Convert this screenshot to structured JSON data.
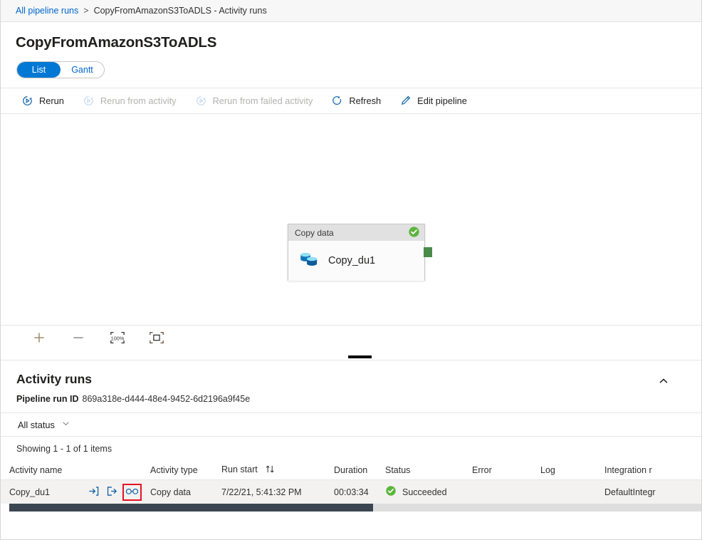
{
  "breadcrumb": {
    "root": "All pipeline runs",
    "separator": ">",
    "current": "CopyFromAmazonS3ToADLS - Activity runs"
  },
  "page": {
    "title": "CopyFromAmazonS3ToADLS"
  },
  "view_toggle": {
    "list_label": "List",
    "gantt_label": "Gantt",
    "selected": "List",
    "active_color": "#0078d4",
    "link_color": "#0066cc"
  },
  "command_bar": {
    "items": [
      {
        "label": "Rerun",
        "icon": "rerun-icon",
        "disabled": false
      },
      {
        "label": "Rerun from activity",
        "icon": "rerun-from-activity-icon",
        "disabled": true
      },
      {
        "label": "Rerun from failed activity",
        "icon": "rerun-from-failed-activity-icon",
        "disabled": true
      },
      {
        "label": "Refresh",
        "icon": "refresh-icon",
        "disabled": false
      },
      {
        "label": "Edit pipeline",
        "icon": "edit-pipeline-icon",
        "disabled": false
      }
    ]
  },
  "canvas": {
    "node": {
      "type_label": "Copy data",
      "name": "Copy_du1",
      "status_icon": "success-check-icon",
      "status_color": "#5cb53c",
      "activity_icon": "copy-data-icon",
      "port_color": "#4a8a4a"
    },
    "zoom_tools": [
      {
        "icon": "zoom-in-icon",
        "label": "+"
      },
      {
        "icon": "zoom-out-icon",
        "label": "—"
      },
      {
        "icon": "zoom-to-100-percent-icon",
        "label": "100%"
      },
      {
        "icon": "zoom-to-fit-icon",
        "label": ""
      }
    ]
  },
  "activity_runs": {
    "title": "Activity runs",
    "run_id_label": "Pipeline run ID",
    "run_id_value": "869a318e-d444-48e4-9452-6d2196a9f45e",
    "collapse_icon": "chevron-up-icon",
    "status_filter": {
      "label": "All status",
      "icon": "chevron-down-icon"
    },
    "showing_text": "Showing 1 - 1 of 1 items",
    "columns": [
      "Activity name",
      "Activity type",
      "Run start",
      "Duration",
      "Status",
      "Error",
      "Log",
      "Integration r"
    ],
    "sort_column": "Run start",
    "sort_icon": "sort-updown-icon",
    "rows": [
      {
        "activity_name": "Copy_du1",
        "row_icons": [
          {
            "name": "input-icon",
            "highlighted": false
          },
          {
            "name": "output-icon",
            "highlighted": false
          },
          {
            "name": "details-glasses-icon",
            "highlighted": true
          }
        ],
        "activity_type": "Copy data",
        "run_start": "7/22/21, 5:41:32 PM",
        "duration": "00:03:34",
        "status": "Succeeded",
        "status_icon": "success-check-icon",
        "status_color": "#5cb53c",
        "error": "",
        "log": "",
        "integration_runtime": "DefaultIntegr"
      }
    ],
    "highlight_color": "#e81123"
  },
  "scrollbar": {
    "orientation": "horizontal",
    "thumb_color": "#3b4652",
    "track_color": "#dedede"
  }
}
